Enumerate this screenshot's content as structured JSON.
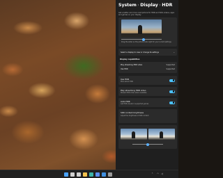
{
  "settings": {
    "breadcrumb": [
      "System",
      "Display",
      "HDR"
    ],
    "description": "Get a better and more vivid picture for HDR and WCG videos, apps and games on your display.",
    "preview": {
      "caption": "Drag the slider so the picture looks right for your current settings.",
      "slider_fraction": 0.55
    },
    "display_select": {
      "label": "Select a display to view or change its settings",
      "value": ""
    },
    "capabilities": {
      "title": "Display capabilities",
      "rows": [
        {
          "label": "Play streaming HDR video",
          "value": "Supported"
        },
        {
          "label": "Use HDR",
          "value": "Supported"
        }
      ]
    },
    "use_hdr": {
      "label": "Use HDR",
      "sub": "More about HDR",
      "on": true
    },
    "streaming_hdr": {
      "label": "Play streaming HDR video",
      "sub": "Stream HDR video when available",
      "on": true
    },
    "auto_hdr": {
      "label": "Auto HDR",
      "sub": "Get HDR visuals in supported games",
      "on": true
    },
    "calibration": {
      "label": "SDR content brightness",
      "sub": "Adjust the brightness of SDR content",
      "slider_fraction": 0.5
    }
  },
  "taskbar": {
    "icons": [
      "start-icon",
      "search-icon",
      "task-view-icon",
      "file-explorer-icon",
      "edge-icon",
      "store-icon",
      "mail-icon",
      "settings-icon"
    ],
    "icon_colors": [
      "#4aa3ff",
      "#d0d0d0",
      "#d0d0d0",
      "#f2c14e",
      "#3bb3a8",
      "#5b8def",
      "#3f8fe0",
      "#9a9a9a"
    ],
    "time": "",
    "date": ""
  },
  "colors": {
    "accent": "#4cc2ff",
    "window_bg": "#1f1f1f",
    "card_bg": "#2b2b2b"
  }
}
